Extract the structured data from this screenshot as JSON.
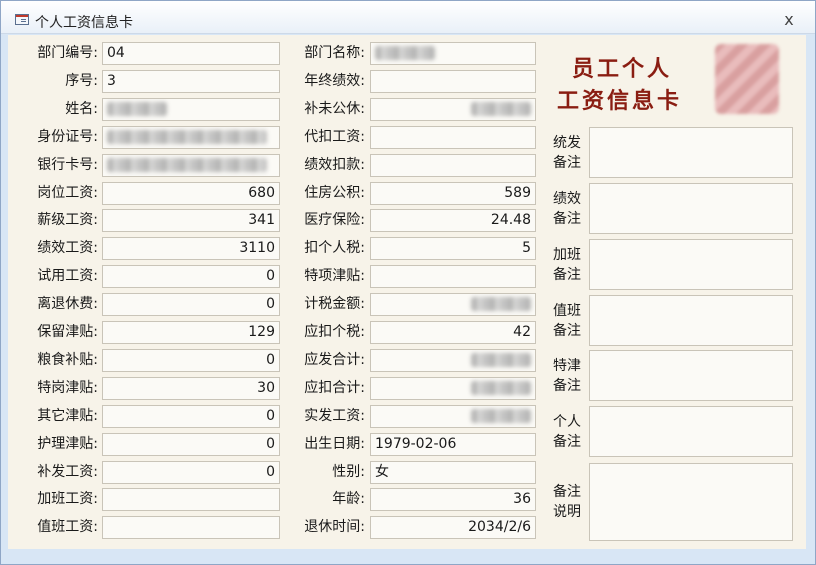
{
  "window": {
    "title": "个人工资信息卡",
    "close_label": "x"
  },
  "card_title": {
    "line1": "员工个人",
    "line2": "工资信息卡"
  },
  "left_fields": [
    {
      "label": "部门编号:",
      "value": "04",
      "align": "left"
    },
    {
      "label": "序号:",
      "value": "3",
      "align": "left"
    },
    {
      "label": "姓名:",
      "value": "",
      "align": "left",
      "blurred": true
    },
    {
      "label": "身份证号:",
      "value": "",
      "align": "left",
      "blurred": true
    },
    {
      "label": "银行卡号:",
      "value": "",
      "align": "left",
      "blurred": true
    },
    {
      "label": "岗位工资:",
      "value": "680",
      "align": "right"
    },
    {
      "label": "薪级工资:",
      "value": "341",
      "align": "right"
    },
    {
      "label": "绩效工资:",
      "value": "3110",
      "align": "right"
    },
    {
      "label": "试用工资:",
      "value": "0",
      "align": "right"
    },
    {
      "label": "离退休费:",
      "value": "0",
      "align": "right"
    },
    {
      "label": "保留津贴:",
      "value": "129",
      "align": "right"
    },
    {
      "label": "粮食补贴:",
      "value": "0",
      "align": "right"
    },
    {
      "label": "特岗津贴:",
      "value": "30",
      "align": "right"
    },
    {
      "label": "其它津贴:",
      "value": "0",
      "align": "right"
    },
    {
      "label": "护理津贴:",
      "value": "0",
      "align": "right"
    },
    {
      "label": "补发工资:",
      "value": "0",
      "align": "right"
    },
    {
      "label": "加班工资:",
      "value": "",
      "align": "right"
    },
    {
      "label": "值班工资:",
      "value": "",
      "align": "right"
    }
  ],
  "mid_fields": [
    {
      "label": "部门名称:",
      "value": "",
      "align": "left",
      "blurred": true
    },
    {
      "label": "年终绩效:",
      "value": "",
      "align": "right"
    },
    {
      "label": "补未公休:",
      "value": "",
      "align": "right",
      "blurred": true
    },
    {
      "label": "代扣工资:",
      "value": "",
      "align": "right"
    },
    {
      "label": "绩效扣款:",
      "value": "",
      "align": "right"
    },
    {
      "label": "住房公积:",
      "value": "589",
      "align": "right"
    },
    {
      "label": "医疗保险:",
      "value": "24.48",
      "align": "right"
    },
    {
      "label": "扣个人税:",
      "value": "5",
      "align": "right"
    },
    {
      "label": "特项津贴:",
      "value": "",
      "align": "right"
    },
    {
      "label": "计税金额:",
      "value": "",
      "align": "right",
      "blurred": true
    },
    {
      "label": "应扣个税:",
      "value": "42",
      "align": "right"
    },
    {
      "label": "应发合计:",
      "value": "",
      "align": "right",
      "blurred": true
    },
    {
      "label": "应扣合计:",
      "value": "",
      "align": "right",
      "blurred": true
    },
    {
      "label": "实发工资:",
      "value": "",
      "align": "right",
      "blurred": true
    },
    {
      "label": "出生日期:",
      "value": "1979-02-06",
      "align": "left"
    },
    {
      "label": "性别:",
      "value": "女",
      "align": "left"
    },
    {
      "label": "年龄:",
      "value": "36",
      "align": "right"
    },
    {
      "label": "退休时间:",
      "value": "2034/2/6",
      "align": "right"
    }
  ],
  "notes": [
    {
      "line1": "统发",
      "line2": "备注"
    },
    {
      "line1": "绩效",
      "line2": "备注"
    },
    {
      "line1": "加班",
      "line2": "备注"
    },
    {
      "line1": "值班",
      "line2": "备注"
    },
    {
      "line1": "特津",
      "line2": "备注"
    },
    {
      "line1": "个人",
      "line2": "备注"
    },
    {
      "line1": "备注",
      "line2": "说明"
    }
  ]
}
